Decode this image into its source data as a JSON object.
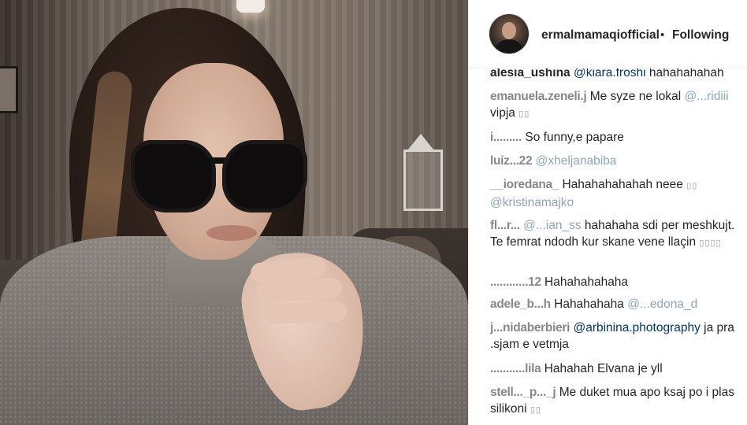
{
  "post": {
    "username": "ermalmamaqiofficial",
    "separator": "•",
    "follow_state": "Following"
  },
  "comments": [
    {
      "user": "alesia_ushina",
      "mention": "@kiara.froshi",
      "text": "hahahahahah",
      "emoji": ""
    },
    {
      "user": "emanuela.zeneli.j",
      "text": "Me syze ne lokal",
      "mention": "@...ridiii",
      "text2": "vipja",
      "emoji": "▯▯"
    },
    {
      "user": "i.........",
      "text": "So funny,e papare",
      "mention": "",
      "emoji": ""
    },
    {
      "user": "luiz...22",
      "mention": "@xheljanabiba",
      "text": "",
      "emoji": ""
    },
    {
      "user": "__ioredana_",
      "text": "Hahahahahahah neee",
      "mention": "@kristinamajko",
      "emoji": "▯▯"
    },
    {
      "user": "fl...r...",
      "mention": "@...ian_ss",
      "text": "hahahaha sdi per meshkujt. Te femrat ndodh kur skane vene llaçin",
      "emoji": "▯▯▯▯"
    },
    {
      "user": "............12",
      "text": "Hahahahahaha",
      "mention": "",
      "emoji": ""
    },
    {
      "user": "adele_b...h",
      "text": "Hahahahaha",
      "mention": "@...edona_d",
      "emoji": ""
    },
    {
      "user": "j...nidaberbieri",
      "mention": "@arbinina.photography",
      "text": "ja pra .sjam e vetmja",
      "emoji": ""
    },
    {
      "user": "...........lila",
      "text": "Hahahah Elvana je yll",
      "mention": "",
      "emoji": ""
    },
    {
      "user": "stell..._p..._j",
      "text": "Me duket mua apo ksaj po i plas silikoni",
      "mention": "",
      "emoji": "▯▯"
    }
  ]
}
